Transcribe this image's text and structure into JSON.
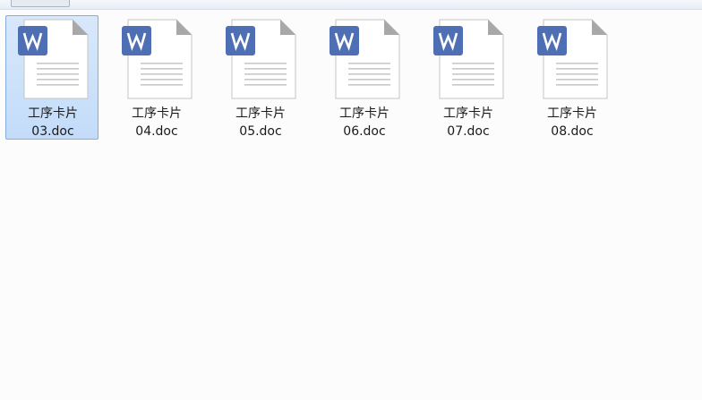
{
  "files": [
    {
      "name": "工序卡片03.doc",
      "line1": "工序卡片",
      "line2": "03.doc",
      "selected": true,
      "icon": "wps-writer-doc-icon"
    },
    {
      "name": "工序卡片04.doc",
      "line1": "工序卡片",
      "line2": "04.doc",
      "selected": false,
      "icon": "wps-writer-doc-icon"
    },
    {
      "name": "工序卡片05.doc",
      "line1": "工序卡片",
      "line2": "05.doc",
      "selected": false,
      "icon": "wps-writer-doc-icon"
    },
    {
      "name": "工序卡片06.doc",
      "line1": "工序卡片",
      "line2": "06.doc",
      "selected": false,
      "icon": "wps-writer-doc-icon"
    },
    {
      "name": "工序卡片07.doc",
      "line1": "工序卡片",
      "line2": "07.doc",
      "selected": false,
      "icon": "wps-writer-doc-icon"
    },
    {
      "name": "工序卡片08.doc",
      "line1": "工序卡片",
      "line2": "08.doc",
      "selected": false,
      "icon": "wps-writer-doc-icon"
    }
  ],
  "colors": {
    "wps_badge": "#4f6fb5",
    "selection_fill": "#cce0fa",
    "selection_border": "#84acdd"
  }
}
